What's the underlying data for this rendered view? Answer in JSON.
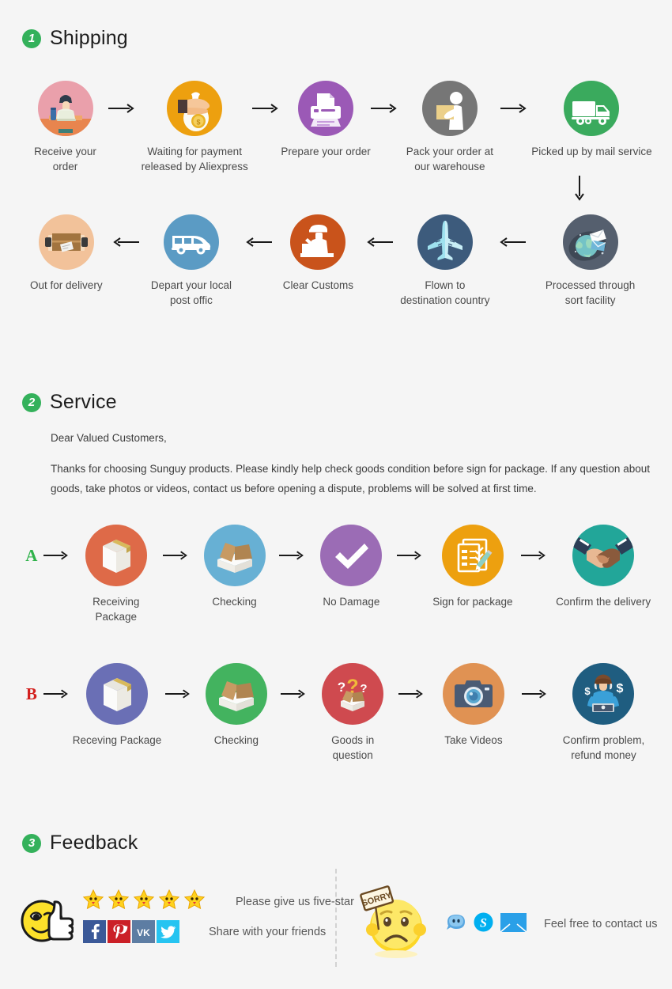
{
  "background": "#f5f5f5",
  "accent_green": "#34b15b",
  "sections": [
    {
      "number": "1",
      "title": "Shipping"
    },
    {
      "number": "2",
      "title": "Service"
    },
    {
      "number": "3",
      "title": "Feedback"
    }
  ],
  "shipping": {
    "row1": [
      {
        "label": "Receive your order",
        "icon": "person-at-laptop-icon",
        "color": "#eaa0ab"
      },
      {
        "label": "Waiting for payment\nreleased by Aliexpress",
        "icon": "hand-money-bag-icon",
        "color": "#eda00f"
      },
      {
        "label": "Prepare your order",
        "icon": "printer-icon",
        "color": "#9b59b6"
      },
      {
        "label": "Pack your order at\nour warehouse",
        "icon": "worker-packing-icon",
        "color": "#767676"
      },
      {
        "label": "Picked up by mail service",
        "icon": "delivery-truck-icon",
        "color": "#3aaa5d"
      }
    ],
    "row2": [
      {
        "label": "Out for delivery",
        "icon": "open-parcel-icon",
        "color": "#f2c29a"
      },
      {
        "label": "Depart your local\npost offic",
        "icon": "delivery-van-icon",
        "color": "#5b9bc4"
      },
      {
        "label": "Clear  Customs",
        "icon": "customs-officer-icon",
        "color": "#c9531b"
      },
      {
        "label": "Flown to\ndestination country",
        "icon": "airplane-icon",
        "color": "#3d5b7c"
      },
      {
        "label": "Processed through\nsort facility",
        "icon": "globe-mail-icon",
        "color": "#555f6e"
      }
    ],
    "arrow_right": "right-arrow-icon",
    "arrow_left": "left-arrow-icon",
    "arrow_down": "down-arrow-icon"
  },
  "service": {
    "greeting": "Dear Valued Customers,",
    "body": "Thanks for choosing Sunguy products. Please kindly help check goods condition before sign for package. If any question about goods, take photos or videos, contact us before opening a dispute, problems will be solved at first time.",
    "rowA": {
      "label": "A",
      "label_color": "#2fb24a",
      "steps": [
        {
          "label": "Receiving Package",
          "icon": "closed-box-icon",
          "color": "#de6a48"
        },
        {
          "label": "Checking",
          "icon": "open-box-icon",
          "color": "#67b0d4"
        },
        {
          "label": "No Damage",
          "icon": "checkmark-icon",
          "color": "#9b6cb5"
        },
        {
          "label": "Sign for package",
          "icon": "signed-document-icon",
          "color": "#eda00f"
        },
        {
          "label": "Confirm the delivery",
          "icon": "handshake-icon",
          "color": "#22a699"
        }
      ]
    },
    "rowB": {
      "label": "B",
      "label_color": "#d3201e",
      "steps": [
        {
          "label": "Receving Package",
          "icon": "closed-box-icon",
          "color": "#6a6fb5"
        },
        {
          "label": "Checking",
          "icon": "open-box-icon",
          "color": "#43b35f"
        },
        {
          "label": "Goods in question",
          "icon": "question-box-icon",
          "color": "#cf4a4f"
        },
        {
          "label": "Take Videos",
          "icon": "camera-icon",
          "color": "#e09253"
        },
        {
          "label": "Confirm problem,\nrefund money",
          "icon": "support-agent-icon",
          "color": "#1f5d80"
        }
      ]
    }
  },
  "feedback": {
    "happy_face_icon": "winking-thumbs-up-face-icon",
    "sorry_face_icon": "sad-face-sorry-sign-icon",
    "sorry_sign_text": "SORRY",
    "stars": 5,
    "star_icon": "star-icon",
    "line1": "Please give us five-star",
    "line2": "Share with your friends",
    "line3": "Feel free to contact us",
    "socials": [
      {
        "name": "facebook-icon",
        "glyph": "f",
        "color": "#3b5998"
      },
      {
        "name": "pinterest-icon",
        "glyph": "р",
        "color": "#cb2027"
      },
      {
        "name": "vk-icon",
        "glyph": "vk",
        "color": "#5d7da3"
      },
      {
        "name": "twitter-icon",
        "glyph": "t",
        "color": "#26c4f1"
      }
    ],
    "contacts": [
      {
        "name": "aliexpress-message-icon",
        "color": "#3c9ee0"
      },
      {
        "name": "skype-icon",
        "glyph": "S",
        "color": "#00aff0"
      },
      {
        "name": "email-icon",
        "color": "#2aa0e8"
      }
    ]
  }
}
